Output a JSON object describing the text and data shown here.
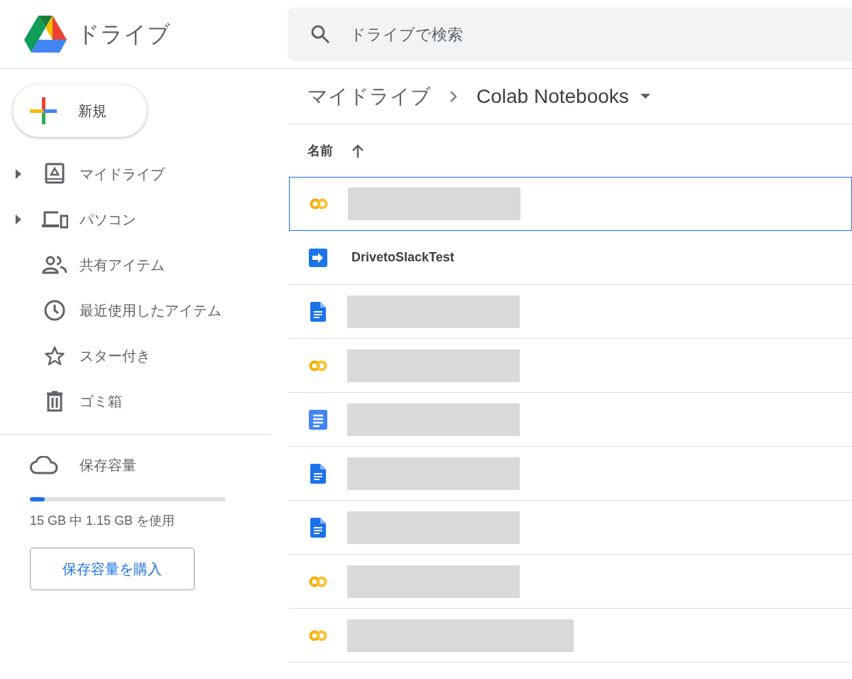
{
  "header": {
    "product_name": "ドライブ",
    "search": {
      "placeholder": "ドライブで検索"
    }
  },
  "sidebar": {
    "new_button": "新規",
    "items": [
      {
        "label": "マイドライブ",
        "kind": "drive",
        "expandable": true
      },
      {
        "label": "パソコン",
        "kind": "computers",
        "expandable": true
      },
      {
        "label": "共有アイテム",
        "kind": "shared",
        "expandable": false
      },
      {
        "label": "最近使用したアイテム",
        "kind": "recent",
        "expandable": false
      },
      {
        "label": "スター付き",
        "kind": "star",
        "expandable": false
      },
      {
        "label": "ゴミ箱",
        "kind": "trash",
        "expandable": false
      }
    ],
    "storage": {
      "label": "保存容量",
      "level": 0.077,
      "usage": "15 GB 中 1.15 GB を使用",
      "buy_button": "保存容量を購入"
    }
  },
  "breadcrumb": {
    "parent": "マイドライブ",
    "current": "Colab Notebooks"
  },
  "file_list": {
    "column": "名前",
    "rows": [
      {
        "kind": "colab",
        "selected": true
      },
      {
        "kind": "script",
        "selected": false,
        "name": "DrivetoSlackTest"
      },
      {
        "kind": "doc",
        "selected": false
      },
      {
        "kind": "colab",
        "selected": false
      },
      {
        "kind": "docs",
        "selected": false
      },
      {
        "kind": "doc",
        "selected": false
      },
      {
        "kind": "doc",
        "selected": false
      },
      {
        "kind": "colab",
        "selected": false
      },
      {
        "kind": "colab",
        "selected": false
      }
    ]
  }
}
